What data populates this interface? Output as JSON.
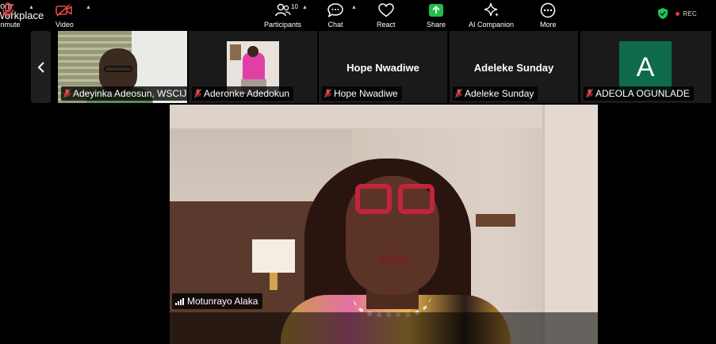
{
  "app": {
    "brand_line1": "oom",
    "brand_line2": "Workplace"
  },
  "status": {
    "rec_label": "REC",
    "rec_color": "#e53935",
    "secure_color": "#21c35b"
  },
  "strip": {
    "prev_icon": "chevron-left-icon",
    "tiles": [
      {
        "name": "Adeyinka Adeosun, WSCIJ",
        "muted": true,
        "type": "video"
      },
      {
        "name": "Aderonke Adedokun",
        "muted": true,
        "type": "photo"
      },
      {
        "name": "Hope Nwadiwe",
        "display": "Hope Nwadiwe",
        "muted": true,
        "type": "name"
      },
      {
        "name": "Adeleke Sunday",
        "display": "Adeleke Sunday",
        "muted": true,
        "type": "name"
      },
      {
        "name": "ADEOLA OGUNLADE",
        "avatar_letter": "A",
        "avatar_color": "#0e6a4b",
        "muted": true,
        "type": "avatar"
      }
    ]
  },
  "main_speaker": {
    "name": "Motunrayo Alaka"
  },
  "toolbar": {
    "unmute": "Unmute",
    "video": "Video",
    "participants": "Participants",
    "participants_count": "10",
    "chat": "Chat",
    "react": "React",
    "share": "Share",
    "ai_companion": "AI Companion",
    "more": "More",
    "share_color": "#1fbf4c",
    "mute_icon_color": "#e5484d"
  }
}
